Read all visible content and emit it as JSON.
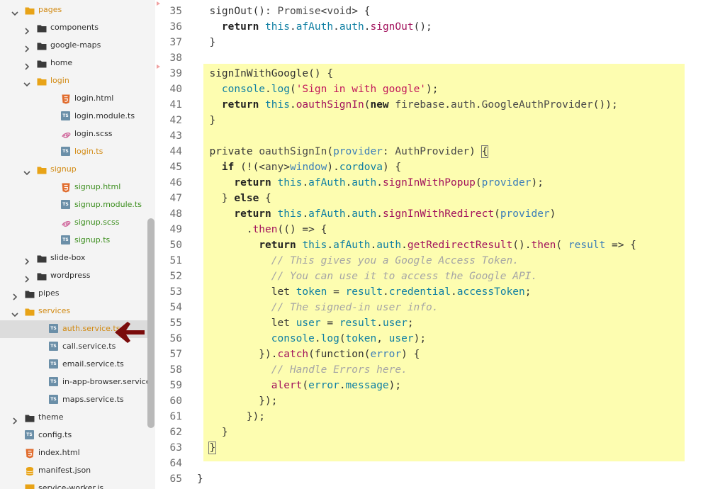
{
  "file_tree": [
    {
      "label": "pages",
      "indent": 1,
      "type": "folder",
      "expanded": true,
      "color": "orange"
    },
    {
      "label": "components",
      "indent": 2,
      "type": "folder",
      "expanded": false,
      "color": "dark"
    },
    {
      "label": "google-maps",
      "indent": 2,
      "type": "folder",
      "expanded": false,
      "color": "dark"
    },
    {
      "label": "home",
      "indent": 2,
      "type": "folder",
      "expanded": false,
      "color": "dark"
    },
    {
      "label": "login",
      "indent": 2,
      "type": "folder",
      "expanded": true,
      "color": "orange"
    },
    {
      "label": "login.html",
      "indent": 3,
      "type": "html",
      "color": "dark"
    },
    {
      "label": "login.module.ts",
      "indent": 3,
      "type": "ts",
      "color": "dark"
    },
    {
      "label": "login.scss",
      "indent": 3,
      "type": "scss",
      "color": "dark"
    },
    {
      "label": "login.ts",
      "indent": 3,
      "type": "ts",
      "color": "orange"
    },
    {
      "label": "signup",
      "indent": 2,
      "type": "folder",
      "expanded": true,
      "color": "orange"
    },
    {
      "label": "signup.html",
      "indent": 3,
      "type": "html",
      "color": "green"
    },
    {
      "label": "signup.module.ts",
      "indent": 3,
      "type": "ts",
      "color": "green"
    },
    {
      "label": "signup.scss",
      "indent": 3,
      "type": "scss",
      "color": "green"
    },
    {
      "label": "signup.ts",
      "indent": 3,
      "type": "ts",
      "color": "green"
    },
    {
      "label": "slide-box",
      "indent": 2,
      "type": "folder",
      "expanded": false,
      "color": "dark"
    },
    {
      "label": "wordpress",
      "indent": 2,
      "type": "folder",
      "expanded": false,
      "color": "dark"
    },
    {
      "label": "pipes",
      "indent": 1,
      "type": "folder",
      "expanded": false,
      "color": "dark"
    },
    {
      "label": "services",
      "indent": 1,
      "type": "folder",
      "expanded": true,
      "color": "orange"
    },
    {
      "label": "auth.service.ts",
      "indent": 2,
      "type": "ts",
      "color": "orange",
      "selected": true
    },
    {
      "label": "call.service.ts",
      "indent": 2,
      "type": "ts",
      "color": "dark"
    },
    {
      "label": "email.service.ts",
      "indent": 2,
      "type": "ts",
      "color": "dark"
    },
    {
      "label": "in-app-browser.service.ts",
      "indent": 2,
      "type": "ts",
      "color": "dark"
    },
    {
      "label": "maps.service.ts",
      "indent": 2,
      "type": "ts",
      "color": "dark"
    },
    {
      "label": "theme",
      "indent": 1,
      "type": "folder",
      "expanded": false,
      "color": "dark"
    },
    {
      "label": "config.ts",
      "indent": 1,
      "type": "ts",
      "color": "dark",
      "leaf": true
    },
    {
      "label": "index.html",
      "indent": 1,
      "type": "html",
      "color": "dark",
      "leaf": true
    },
    {
      "label": "manifest.json",
      "indent": 1,
      "type": "json",
      "color": "dark",
      "leaf": true
    },
    {
      "label": "service-worker.js",
      "indent": 1,
      "type": "js",
      "color": "dark",
      "leaf": true
    }
  ],
  "icons": {
    "folder_dark": "#3a3a3a",
    "folder_orange": "#e8a317",
    "html": "#e06b2c",
    "ts": "#6b8fa8",
    "scss": "#cf649a",
    "json": "#e8a317",
    "arrow": "#7a0b0b",
    "ts_text": "TS"
  },
  "highlight_color": "#fdfdb0",
  "code_lines": [
    {
      "n": "35",
      "t": [
        [
          "  signOut",
          ""
        ],
        [
          "(): ",
          "punc"
        ],
        [
          "Promise",
          "type"
        ],
        [
          "<",
          "op"
        ],
        [
          "void",
          "type"
        ],
        [
          "> {",
          "punc"
        ]
      ]
    },
    {
      "n": "36",
      "t": [
        [
          "    ",
          ""
        ],
        [
          "return",
          "kw"
        ],
        [
          " ",
          ""
        ],
        [
          "this",
          "this"
        ],
        [
          ".",
          "punc"
        ],
        [
          "afAuth",
          "prop"
        ],
        [
          ".",
          "punc"
        ],
        [
          "auth",
          "prop"
        ],
        [
          ".",
          "punc"
        ],
        [
          "signOut",
          "fn"
        ],
        [
          "();",
          "punc"
        ]
      ]
    },
    {
      "n": "37",
      "t": [
        [
          "  }",
          "punc"
        ]
      ]
    },
    {
      "n": "38",
      "t": []
    },
    {
      "n": "39",
      "t": [
        [
          "  signInWithGoogle",
          ""
        ],
        [
          "() {",
          "punc"
        ]
      ]
    },
    {
      "n": "40",
      "t": [
        [
          "    ",
          ""
        ],
        [
          "console",
          "this"
        ],
        [
          ".",
          "punc"
        ],
        [
          "log",
          "prop"
        ],
        [
          "(",
          "punc"
        ],
        [
          "'Sign in with google'",
          "str"
        ],
        [
          ");",
          "punc"
        ]
      ]
    },
    {
      "n": "41",
      "t": [
        [
          "    ",
          ""
        ],
        [
          "return",
          "kw"
        ],
        [
          " ",
          ""
        ],
        [
          "this",
          "this"
        ],
        [
          ".",
          "punc"
        ],
        [
          "oauthSignIn",
          "fn"
        ],
        [
          "(",
          "punc"
        ],
        [
          "new",
          "kw"
        ],
        [
          " ",
          ""
        ],
        [
          "firebase",
          "type"
        ],
        [
          ".",
          "punc"
        ],
        [
          "auth",
          "type"
        ],
        [
          ".",
          "punc"
        ],
        [
          "GoogleAuthProvider",
          "type"
        ],
        [
          "());",
          "punc"
        ]
      ]
    },
    {
      "n": "42",
      "t": [
        [
          "  }",
          "punc"
        ]
      ]
    },
    {
      "n": "43",
      "t": []
    },
    {
      "n": "44",
      "t": [
        [
          "  private ",
          "kwn"
        ],
        [
          "oauthSignIn",
          "type"
        ],
        [
          "(",
          "punc"
        ],
        [
          "provider",
          "param"
        ],
        [
          ": ",
          "punc"
        ],
        [
          "AuthProvider",
          "type"
        ],
        [
          ") ",
          "punc"
        ],
        [
          "{",
          "box"
        ]
      ]
    },
    {
      "n": "45",
      "t": [
        [
          "    ",
          ""
        ],
        [
          "if",
          "kw"
        ],
        [
          " (!(<",
          "punc"
        ],
        [
          "any",
          "type"
        ],
        [
          ">",
          "punc"
        ],
        [
          "window",
          "param"
        ],
        [
          ").",
          "punc"
        ],
        [
          "cordova",
          "prop"
        ],
        [
          ") {",
          "punc"
        ]
      ]
    },
    {
      "n": "46",
      "t": [
        [
          "      ",
          ""
        ],
        [
          "return",
          "kw"
        ],
        [
          " ",
          ""
        ],
        [
          "this",
          "this"
        ],
        [
          ".",
          "punc"
        ],
        [
          "afAuth",
          "prop"
        ],
        [
          ".",
          "punc"
        ],
        [
          "auth",
          "prop"
        ],
        [
          ".",
          "punc"
        ],
        [
          "signInWithPopup",
          "fn"
        ],
        [
          "(",
          "punc"
        ],
        [
          "provider",
          "param"
        ],
        [
          ");",
          "punc"
        ]
      ]
    },
    {
      "n": "47",
      "t": [
        [
          "    } ",
          "punc"
        ],
        [
          "else",
          "kw"
        ],
        [
          " {",
          "punc"
        ]
      ]
    },
    {
      "n": "48",
      "t": [
        [
          "      ",
          ""
        ],
        [
          "return",
          "kw"
        ],
        [
          " ",
          ""
        ],
        [
          "this",
          "this"
        ],
        [
          ".",
          "punc"
        ],
        [
          "afAuth",
          "prop"
        ],
        [
          ".",
          "punc"
        ],
        [
          "auth",
          "prop"
        ],
        [
          ".",
          "punc"
        ],
        [
          "signInWithRedirect",
          "fn"
        ],
        [
          "(",
          "punc"
        ],
        [
          "provider",
          "param"
        ],
        [
          ")",
          "punc"
        ]
      ]
    },
    {
      "n": "49",
      "t": [
        [
          "        .",
          "punc"
        ],
        [
          "then",
          "fn"
        ],
        [
          "(() => {",
          "punc"
        ]
      ]
    },
    {
      "n": "50",
      "t": [
        [
          "          ",
          ""
        ],
        [
          "return",
          "kw"
        ],
        [
          " ",
          ""
        ],
        [
          "this",
          "this"
        ],
        [
          ".",
          "punc"
        ],
        [
          "afAuth",
          "prop"
        ],
        [
          ".",
          "punc"
        ],
        [
          "auth",
          "prop"
        ],
        [
          ".",
          "punc"
        ],
        [
          "getRedirectResult",
          "fn"
        ],
        [
          "().",
          "punc"
        ],
        [
          "then",
          "fn"
        ],
        [
          "( ",
          "punc"
        ],
        [
          "result",
          "param"
        ],
        [
          " => {",
          "punc"
        ]
      ]
    },
    {
      "n": "51",
      "t": [
        [
          "            ",
          ""
        ],
        [
          "// This gives you a Google Access Token.",
          "cm"
        ]
      ]
    },
    {
      "n": "52",
      "t": [
        [
          "            ",
          ""
        ],
        [
          "// You can use it to access the Google API.",
          "cm"
        ]
      ]
    },
    {
      "n": "53",
      "t": [
        [
          "            ",
          ""
        ],
        [
          "let",
          "kwn"
        ],
        [
          " ",
          ""
        ],
        [
          "token",
          "prop"
        ],
        [
          " = ",
          "punc"
        ],
        [
          "result",
          "prop"
        ],
        [
          ".",
          "punc"
        ],
        [
          "credential",
          "prop"
        ],
        [
          ".",
          "punc"
        ],
        [
          "accessToken",
          "prop"
        ],
        [
          ";",
          "punc"
        ]
      ]
    },
    {
      "n": "54",
      "t": [
        [
          "            ",
          ""
        ],
        [
          "// The signed-in user info.",
          "cm"
        ]
      ]
    },
    {
      "n": "55",
      "t": [
        [
          "            ",
          ""
        ],
        [
          "let",
          "kwn"
        ],
        [
          " ",
          ""
        ],
        [
          "user",
          "prop"
        ],
        [
          " = ",
          "punc"
        ],
        [
          "result",
          "prop"
        ],
        [
          ".",
          "punc"
        ],
        [
          "user",
          "prop"
        ],
        [
          ";",
          "punc"
        ]
      ]
    },
    {
      "n": "56",
      "t": [
        [
          "            ",
          ""
        ],
        [
          "console",
          "this"
        ],
        [
          ".",
          "punc"
        ],
        [
          "log",
          "prop"
        ],
        [
          "(",
          "punc"
        ],
        [
          "token",
          "prop"
        ],
        [
          ", ",
          "punc"
        ],
        [
          "user",
          "prop"
        ],
        [
          ");",
          "punc"
        ]
      ]
    },
    {
      "n": "57",
      "t": [
        [
          "          }).",
          "punc"
        ],
        [
          "catch",
          "fn"
        ],
        [
          "(",
          "punc"
        ],
        [
          "function",
          "kwn"
        ],
        [
          "(",
          "punc"
        ],
        [
          "error",
          "param"
        ],
        [
          ") {",
          "punc"
        ]
      ]
    },
    {
      "n": "58",
      "t": [
        [
          "            ",
          ""
        ],
        [
          "// Handle Errors here.",
          "cm"
        ]
      ]
    },
    {
      "n": "59",
      "t": [
        [
          "            ",
          ""
        ],
        [
          "alert",
          "fn"
        ],
        [
          "(",
          "punc"
        ],
        [
          "error",
          "prop"
        ],
        [
          ".",
          "punc"
        ],
        [
          "message",
          "prop"
        ],
        [
          ");",
          "punc"
        ]
      ]
    },
    {
      "n": "60",
      "t": [
        [
          "          });",
          "punc"
        ]
      ]
    },
    {
      "n": "61",
      "t": [
        [
          "        });",
          "punc"
        ]
      ]
    },
    {
      "n": "62",
      "t": [
        [
          "    }",
          "punc"
        ]
      ]
    },
    {
      "n": "63",
      "t": [
        [
          "  ",
          ""
        ],
        [
          "}",
          "box"
        ]
      ]
    },
    {
      "n": "64",
      "t": []
    },
    {
      "n": "65",
      "t": [
        [
          "}",
          "punc"
        ]
      ]
    }
  ]
}
